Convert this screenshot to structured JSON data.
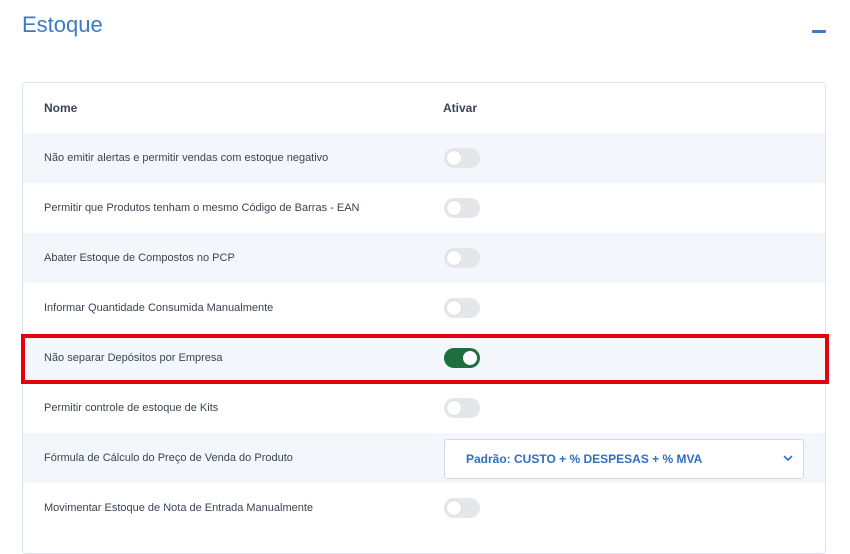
{
  "section": {
    "title": "Estoque"
  },
  "table": {
    "headers": {
      "name": "Nome",
      "active": "Ativar"
    },
    "rows": [
      {
        "label": "Não emitir alertas e permitir vendas com estoque negativo",
        "enabled": false
      },
      {
        "label": "Permitir que Produtos tenham o mesmo Código de Barras - EAN",
        "enabled": false
      },
      {
        "label": "Abater Estoque de Compostos no PCP",
        "enabled": false
      },
      {
        "label": "Informar Quantidade Consumida Manualmente",
        "enabled": false
      },
      {
        "label": "Não separar Depósitos por Empresa",
        "enabled": true
      },
      {
        "label": "Permitir controle de estoque de Kits",
        "enabled": false
      },
      {
        "label": "Fórmula de Cálculo do Preço de Venda do Produto",
        "select_value": "Padrão: CUSTO + % DESPESAS + % MVA"
      },
      {
        "label": "Movimentar Estoque de Nota de Entrada Manualmente",
        "enabled": false
      }
    ]
  },
  "colors": {
    "accent": "#3a7bc8",
    "toggle_on": "#1f6e3e",
    "toggle_off": "#e4e6e9",
    "highlight": "#e3000f",
    "row_alt": "#f3f7fb"
  },
  "icons": {
    "collapse": "minus-icon",
    "select_chevron": "chevron-down-icon"
  }
}
